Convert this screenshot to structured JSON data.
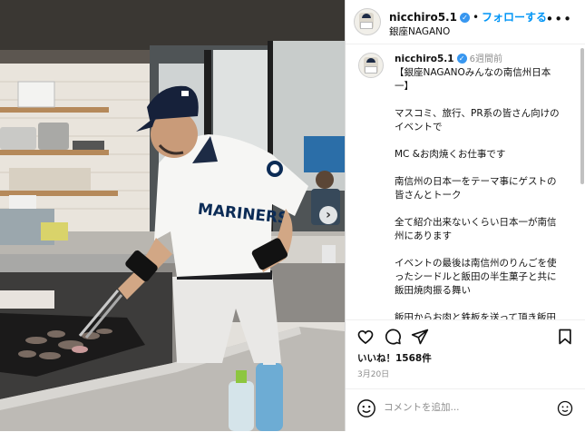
{
  "post": {
    "username": "nicchiro5.1",
    "verified_icon": "verified-badge-icon",
    "separator": "•",
    "follow_label": "フォローする",
    "location": "銀座NAGANO",
    "more_icon": "more-options-icon"
  },
  "caption": {
    "username": "nicchiro5.1",
    "time": "6週間前",
    "lines": [
      "【銀座NAGANOみんなの南信州日本",
      "一】",
      "",
      "マスコミ、旅行、PR系の皆さん向けの",
      "イベントで",
      "",
      "MC &お肉焼くお仕事です",
      "",
      "南信州の日本一をテーマ事にゲストの",
      "皆さんとトーク",
      "",
      "全て紹介出来ないくらい日本一が南信",
      "州にあります",
      "",
      "イベントの最後は南信州のりんごを使",
      "ったシードルと飯田の半生菓子と共に",
      "飯田焼肉振る舞い",
      "",
      "飯田からお肉と鉄板を送って頂き飯田"
    ]
  },
  "photo": {
    "jersey_text": "MARINERS",
    "next_icon": "chevron-right-icon"
  },
  "actions": {
    "like_icon": "heart-icon",
    "comment_icon": "comment-icon",
    "share_icon": "share-icon",
    "save_icon": "bookmark-icon"
  },
  "likes_text": "いいね！1568件",
  "date": "3月20日",
  "comment": {
    "placeholder": "コメントを追加...",
    "emoji_icon": "emoji-icon"
  },
  "colors": {
    "accent": "#0095f6",
    "verified": "#3897f0",
    "muted": "#8e8e8e",
    "border": "#dbdbdb"
  }
}
